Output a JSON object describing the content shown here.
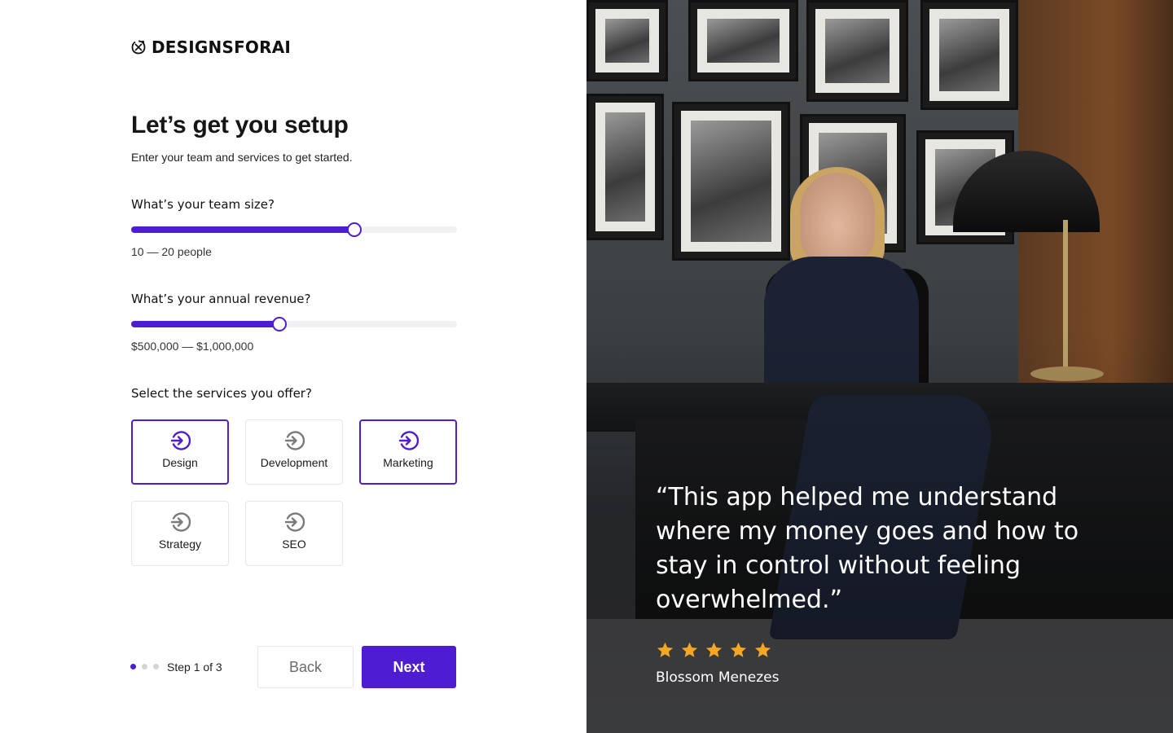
{
  "brand": {
    "name": "DESIGNSFORAI",
    "icon": "brand-logo-icon"
  },
  "header": {
    "title": "Let’s get you setup",
    "subtitle": "Enter your team and services to get started."
  },
  "team_size": {
    "label": "What’s your team size?",
    "value_text": "10 — 20 people",
    "slider_fraction": 0.685
  },
  "revenue": {
    "label": "What’s your annual revenue?",
    "value_text": "$500,000 — $1,000,000",
    "slider_fraction": 0.455
  },
  "services": {
    "label": "Select the services you offer?",
    "items": [
      {
        "label": "Design",
        "selected": true,
        "icon": "arrow-in-circle-icon"
      },
      {
        "label": "Development",
        "selected": false,
        "icon": "arrow-in-circle-icon"
      },
      {
        "label": "Marketing",
        "selected": true,
        "icon": "arrow-in-circle-icon"
      },
      {
        "label": "Strategy",
        "selected": false,
        "icon": "arrow-in-circle-icon"
      },
      {
        "label": "SEO",
        "selected": false,
        "icon": "arrow-in-circle-icon"
      }
    ]
  },
  "footer": {
    "step_text": "Step 1 of 3",
    "current_step": 1,
    "total_steps": 3,
    "back_label": "Back",
    "next_label": "Next"
  },
  "testimonial": {
    "quote": "“This app helped me understand where my money goes and how to stay in control without feeling overwhelmed.”",
    "rating": 5,
    "author": "Blossom Menezes"
  },
  "colors": {
    "accent": "#4f1dd1",
    "star": "#f5a623",
    "track": "#f1f1f3",
    "border": "#e6e6e9"
  }
}
